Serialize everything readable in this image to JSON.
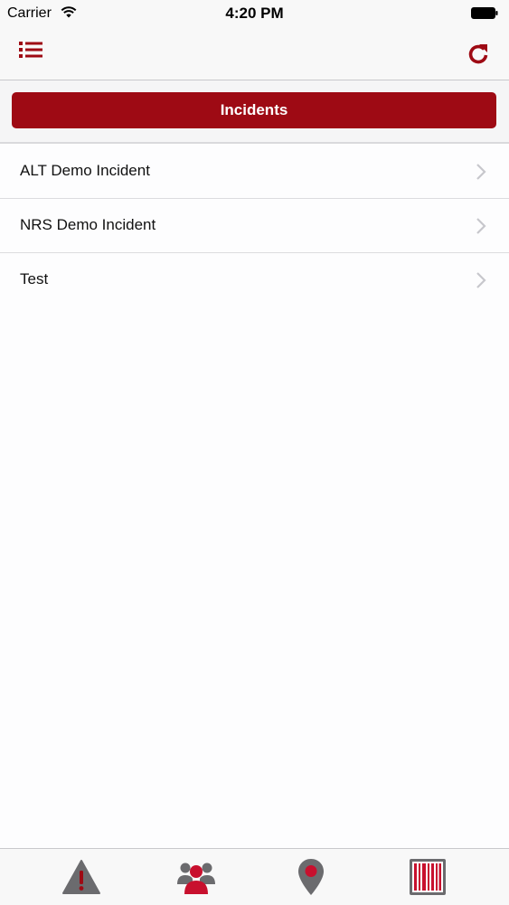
{
  "status_bar": {
    "carrier": "Carrier",
    "time": "4:20 PM"
  },
  "header": {
    "title": "Incidents",
    "menu_icon": "list-menu-icon",
    "refresh_icon": "refresh-icon"
  },
  "incidents": [
    {
      "label": "ALT Demo Incident"
    },
    {
      "label": "NRS Demo Incident"
    },
    {
      "label": "Test"
    }
  ],
  "tab_bar": {
    "tabs": [
      {
        "icon": "warning-icon",
        "active": false
      },
      {
        "icon": "people-icon",
        "active": true
      },
      {
        "icon": "location-pin-icon",
        "active": false
      },
      {
        "icon": "barcode-icon",
        "active": false
      }
    ]
  },
  "colors": {
    "accent": "#9e0a14",
    "icon_gray": "#6b6b6e",
    "chevron": "#c7c7cc"
  }
}
